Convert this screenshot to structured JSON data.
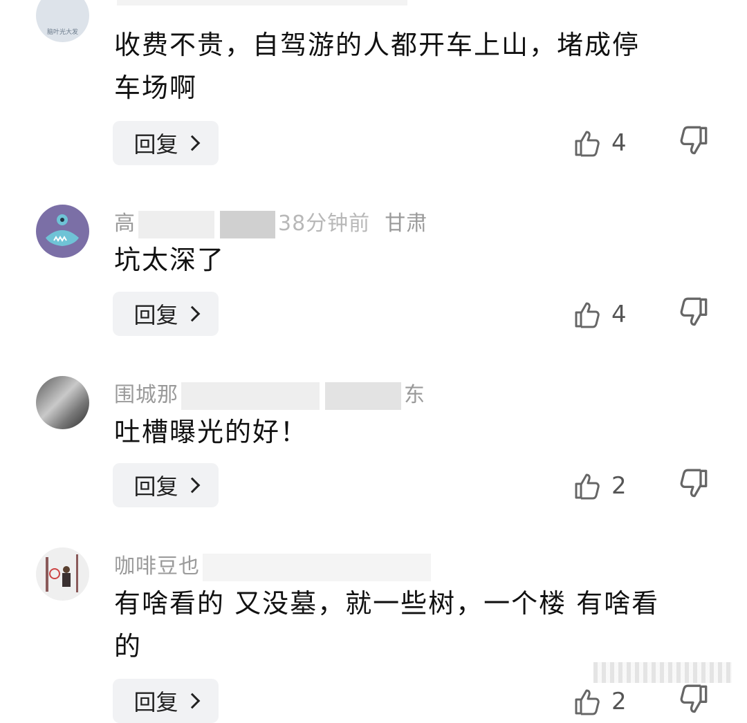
{
  "comments": [
    {
      "meta_visible": "",
      "avatar_text": "脑叶光大发",
      "text": "收费不贵，自驾游的人都开车上山，堵成停车场啊",
      "text_line1": "收费不贵，自驾游的人都开车上山，堵成停",
      "text_line2": "车场啊",
      "reply_label": "回复",
      "likes": "4"
    },
    {
      "meta_name_prefix": "高",
      "meta_time": "38分钟前",
      "meta_location": "甘肃",
      "text": "坑太深了",
      "reply_label": "回复",
      "likes": "4"
    },
    {
      "meta_name_prefix": "围城那",
      "meta_location_suffix": "东",
      "text": "吐槽曝光的好！",
      "reply_label": "回复",
      "likes": "2"
    },
    {
      "meta_name_prefix": "咖啡豆也",
      "text_line1": "有啥看的 又没墓，就一些树，一个楼 有啥看",
      "text_line2": "的",
      "reply_label": "回复",
      "likes": "2"
    }
  ],
  "icons": {
    "like": "thumbs-up-icon",
    "dislike": "thumbs-down-icon",
    "reply_arrow": "chevron-right-icon"
  }
}
